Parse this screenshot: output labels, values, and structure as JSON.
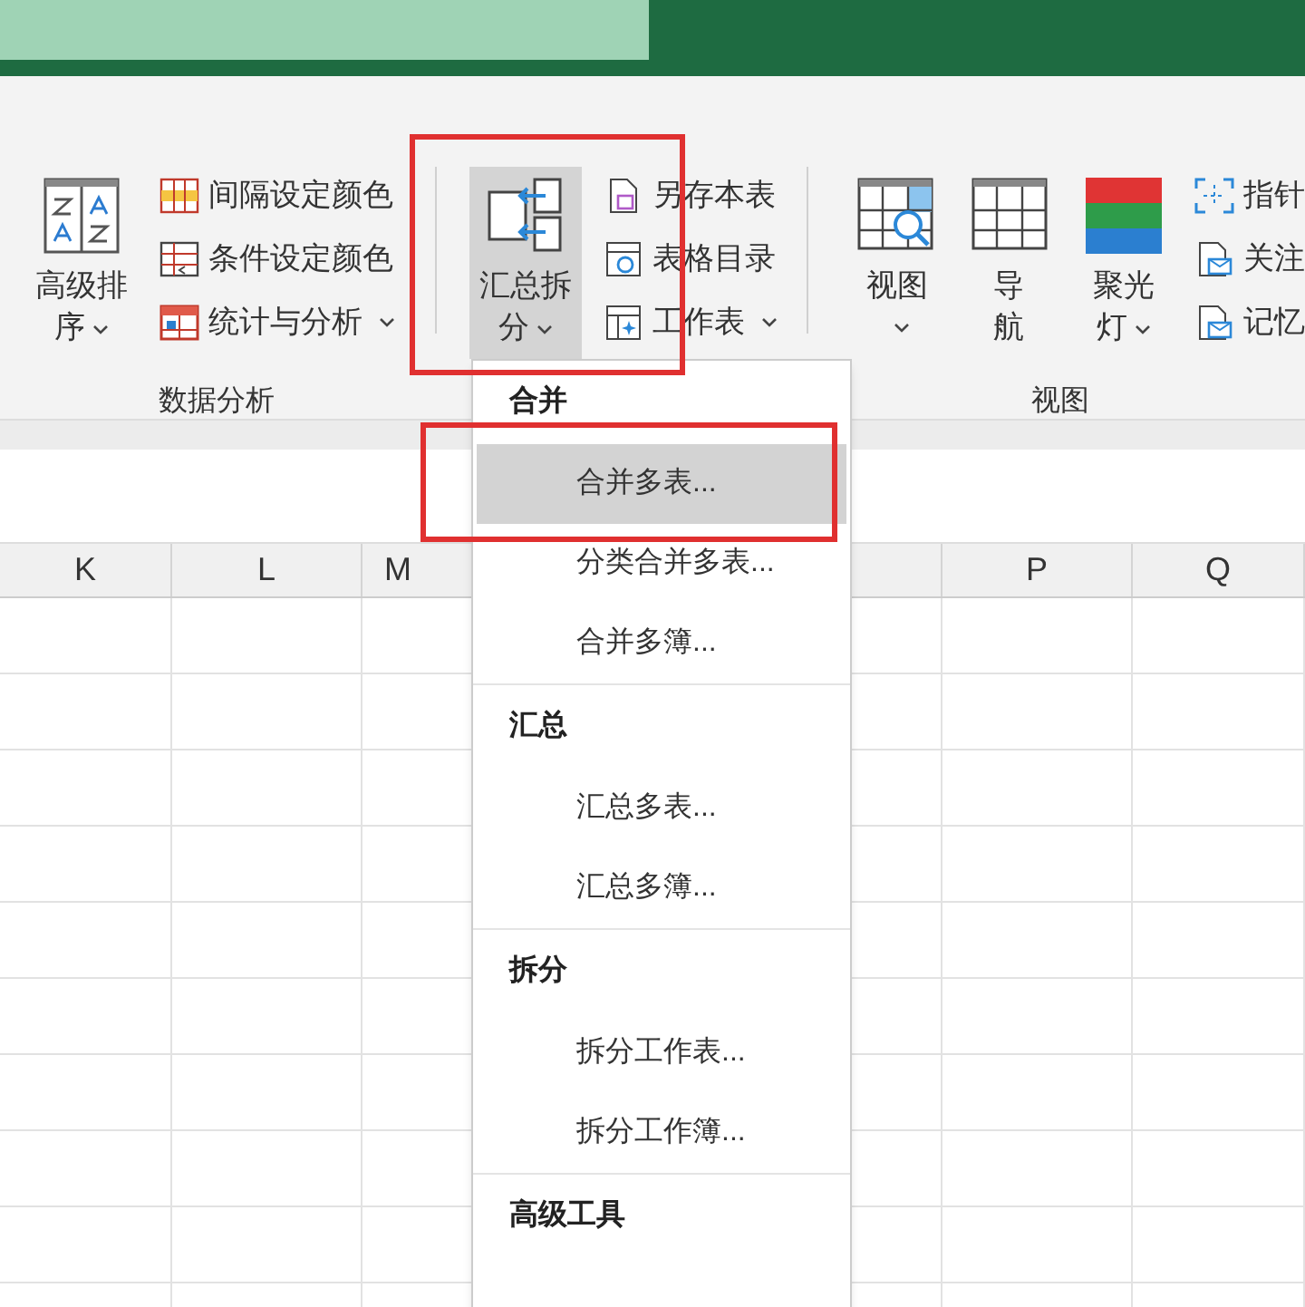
{
  "ribbon": {
    "groups": [
      {
        "label": "数据分析",
        "large": [
          {
            "kind": "sort",
            "lines": [
              "高级排",
              "序"
            ],
            "dropdown": true,
            "pressed": false
          }
        ],
        "small": [
          {
            "kind": "interval",
            "label": "间隔设定颜色",
            "dropdown": false
          },
          {
            "kind": "condition",
            "label": "条件设定颜色",
            "dropdown": false
          },
          {
            "kind": "stats",
            "label": "统计与分析",
            "dropdown": true
          }
        ]
      },
      {
        "large": [
          {
            "kind": "merge",
            "lines": [
              "汇总拆",
              "分"
            ],
            "dropdown": true,
            "pressed": true
          }
        ],
        "small": [
          {
            "kind": "save",
            "label": "另存本表",
            "dropdown": false
          },
          {
            "kind": "catalog",
            "label": "表格目录",
            "dropdown": false
          },
          {
            "kind": "sheet",
            "label": "工作表",
            "dropdown": true
          }
        ]
      },
      {
        "label": "视图",
        "large": [
          {
            "kind": "view",
            "lines": [
              "视图"
            ],
            "dropdown": true,
            "pressed": false
          },
          {
            "kind": "grid",
            "lines": [
              "导",
              "航"
            ],
            "dropdown": false,
            "pressed": false
          },
          {
            "kind": "spotlight",
            "lines": [
              "聚光",
              "灯"
            ],
            "dropdown": true,
            "pressed": false
          }
        ],
        "small": [
          {
            "kind": "pointer",
            "label": "指针",
            "dropdown": false
          },
          {
            "kind": "focus",
            "label": "关注",
            "dropdown": false
          },
          {
            "kind": "memory",
            "label": "记忆",
            "dropdown": false
          }
        ]
      }
    ]
  },
  "sheet": {
    "columns": [
      {
        "label": "K"
      },
      {
        "label": "L"
      },
      {
        "label": "M"
      },
      {
        "label": "P"
      },
      {
        "label": "Q"
      }
    ]
  },
  "menu": {
    "sections": [
      {
        "title": "合并",
        "items": [
          {
            "label": "合并多表...",
            "selected": true
          },
          {
            "label": "分类合并多表...",
            "selected": false
          },
          {
            "label": "合并多簿...",
            "selected": false
          }
        ]
      },
      {
        "title": "汇总",
        "items": [
          {
            "label": "汇总多表...",
            "selected": false
          },
          {
            "label": "汇总多簿...",
            "selected": false
          }
        ]
      },
      {
        "title": "拆分",
        "items": [
          {
            "label": "拆分工作表...",
            "selected": false
          },
          {
            "label": "拆分工作簿...",
            "selected": false
          }
        ]
      },
      {
        "title": "高级工具"
      }
    ]
  }
}
